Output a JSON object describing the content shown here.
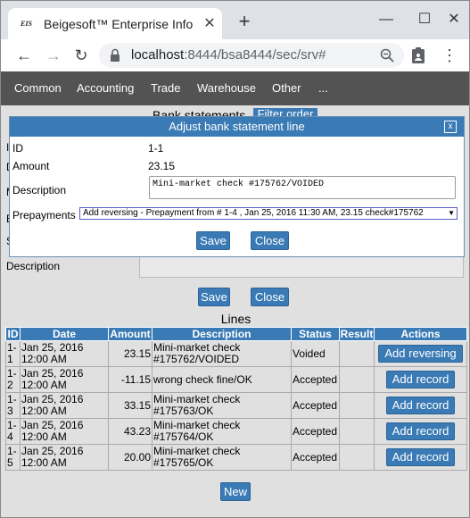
{
  "browser": {
    "tab_favicon": "EIS",
    "tab_title": "Beigesoft™ Enterprise Info",
    "tab_close": "✕",
    "new_tab": "+",
    "minimize": "—",
    "maximize": "☐",
    "close": "✕",
    "url_host": "localhost",
    "url_rest": ":8444/bsa8444/sec/srv#",
    "back": "←",
    "forward": "→",
    "reload": "↻",
    "menu": "⋮"
  },
  "appmenu": {
    "items": [
      "Common",
      "Accounting",
      "Trade",
      "Warehouse",
      "Other",
      "..."
    ]
  },
  "background": {
    "title": "Bank statements",
    "filter_button": "Filter order",
    "labels": [
      "ID",
      "D",
      "M",
      "E",
      "S"
    ],
    "description_label": "Description",
    "save_button": "Save",
    "close_button": "Close"
  },
  "dialog": {
    "title": "Adjust bank statement line",
    "close": "x",
    "fields": {
      "id_label": "ID",
      "id_value": "1-1",
      "amount_label": "Amount",
      "amount_value": "23.15",
      "description_label": "Description",
      "description_value": "Mini-market check #175762/VOIDED",
      "prepayments_label": "Prepayments",
      "prepayments_value": "Add reversing - Prepayment from # 1-4 , Jan 25, 2016 11:30 AM, 23.15 check#175762"
    },
    "save_button": "Save",
    "close_button": "Close"
  },
  "lines": {
    "title": "Lines",
    "columns": [
      "ID",
      "Date",
      "Amount",
      "Description",
      "Status",
      "Result",
      "Actions"
    ],
    "rows": [
      {
        "id": "1-1",
        "date": "Jan 25, 2016 12:00 AM",
        "amount": "23.15",
        "description": "Mini-market check #175762/VOIDED",
        "status": "Voided",
        "result": "",
        "action": "Add reversing"
      },
      {
        "id": "1-2",
        "date": "Jan 25, 2016 12:00 AM",
        "amount": "-11.15",
        "description": "wrong check fine/OK",
        "status": "Accepted",
        "result": "",
        "action": "Add record"
      },
      {
        "id": "1-3",
        "date": "Jan 25, 2016 12:00 AM",
        "amount": "33.15",
        "description": "Mini-market check #175763/OK",
        "status": "Accepted",
        "result": "",
        "action": "Add record"
      },
      {
        "id": "1-4",
        "date": "Jan 25, 2016 12:00 AM",
        "amount": "43.23",
        "description": "Mini-market check #175764/OK",
        "status": "Accepted",
        "result": "",
        "action": "Add record"
      },
      {
        "id": "1-5",
        "date": "Jan 25, 2016 12:00 AM",
        "amount": "20.00",
        "description": "Mini-market check #175765/OK",
        "status": "Accepted",
        "result": "",
        "action": "Add record"
      }
    ],
    "new_button": "New"
  }
}
